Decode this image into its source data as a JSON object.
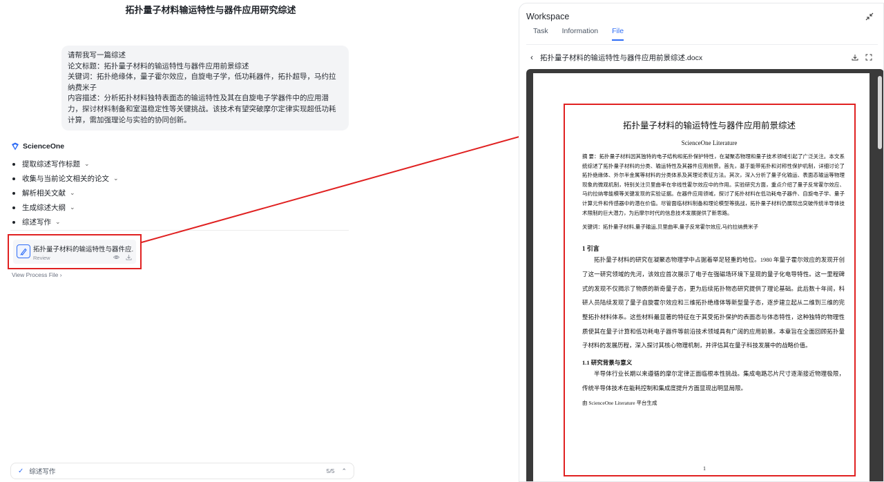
{
  "chat": {
    "title": "拓扑量子材料输运特性与器件应用研究综述",
    "user_message": {
      "lines": [
        "请帮我写一篇综述",
        "论文标题：拓扑量子材料的输运特性与器件应用前景综述",
        "关键词：拓扑绝缘体，量子霍尔效应，自旋电子学，低功耗器件，拓扑超导，马约拉纳费米子",
        "内容描述：分析拓扑材料独特表面态的输运特性及其在自旋电子学器件中的应用潜力，探讨材料制备和室温稳定性等关键挑战。该技术有望突破摩尔定律实现超低功耗计算，需加强理论与实验的协同创新。"
      ]
    },
    "assistant_name": "ScienceOne",
    "steps": [
      {
        "label": "提取综述写作标题"
      },
      {
        "label": "收集与当前论文相关的论文"
      },
      {
        "label": "解析相关文献"
      },
      {
        "label": "生成综述大纲"
      },
      {
        "label": "综述写作"
      }
    ],
    "file_card": {
      "name": "拓扑量子材料的输运特性与器件应...",
      "subtitle": "Review"
    },
    "view_process_label": "View Process File",
    "status_bar": {
      "label": "综述写作",
      "count": "5/5"
    }
  },
  "workspace": {
    "title": "Workspace",
    "tabs": [
      {
        "label": "Task",
        "active": false
      },
      {
        "label": "Information",
        "active": false
      },
      {
        "label": "File",
        "active": true
      }
    ],
    "document": {
      "filename": "拓扑量子材料的输运特性与器件应用前景综述.docx",
      "page": {
        "title": "拓扑量子材料的输运特性与器件应用前景综述",
        "author": "ScienceOne Literature",
        "abstract": "摘 要：拓扑量子材料因其独特的电子结构和拓扑保护特性，在凝聚态物理和量子技术领域引起了广泛关注。本文系统综述了拓扑量子材料的分类、输运特性及其器件应用前景。首先，基于能带拓扑和对称性保护机制，详细讨论了拓扑绝缘体、外尔半金属等材料的分类体系及其理论表征方法。其次，深入分析了量子化输运、表面态输运等物理现象的微观机制，特别关注贝里曲率在非线性霍尔效应中的作用。实验研究方面，重点介绍了量子反常霍尔效应、马约拉纳零能模等关键发现的实验证据。在器件应用领域，探讨了拓扑材料在低功耗电子器件、自旋电子学、量子计算元件和传感器中的潜在价值。尽管面临材料制备和理论模型等挑战，拓扑量子材料仍展现出突破传统半导体技术限制的巨大潜力，为后摩尔时代的信息技术发展提供了新思路。",
        "keywords": "关键词：拓扑量子材料,量子输运,贝里曲率,量子反常霍尔效应,马约拉纳费米子",
        "section1_heading": "1 引言",
        "section1_body": "拓扑量子材料的研究在凝聚态物理学中占据着举足轻重的地位。1980 年量子霍尔效应的发现开创了这一研究领域的先河，该效应首次展示了电子在强磁场环境下呈现的量子化电导特性。这一里程碑式的发现不仅揭示了物质的新奇量子态，更为后续拓扑物态研究提供了理论基础。此后数十年间，科研人员陆续发现了量子自旋霍尔效应和三维拓扑绝缘体等新型量子态，逐步建立起从二维到三维的完整拓扑材料体系。这些材料最显著的特征在于其受拓扑保护的表面态与体态特性，这种独特的物理性质使其在量子计算和低功耗电子器件等前沿技术领域具有广阔的应用前景。本章旨在全面回顾拓扑量子材料的发展历程，深入探讨其核心物理机制，并评估其在量子科技发展中的战略价值。",
        "section11_heading": "1.1 研究背景与意义",
        "section11_body": "半导体行业长期以来遵循的摩尔定律正面临根本性挑战。集成电路芯片尺寸逐渐接近物理极限，传统半导体技术在能耗控制和集成度提升方面显现出明显局限。",
        "footer": "由 ScienceOne Literature 平台生成",
        "page_number": "1"
      }
    }
  },
  "colors": {
    "accent": "#2d6cf6",
    "highlight_red": "#e02020"
  }
}
